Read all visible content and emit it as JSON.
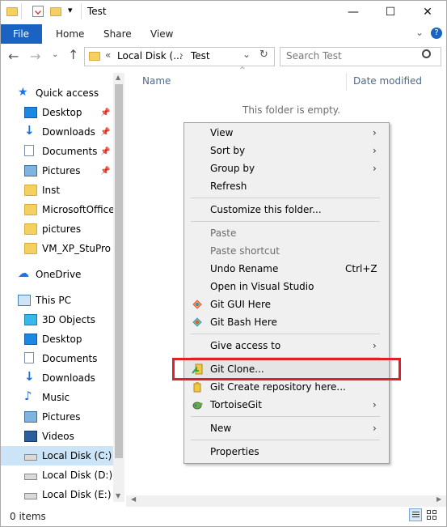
{
  "window": {
    "title": "Test",
    "minimize": "—",
    "maximize": "☐",
    "close": "✕"
  },
  "ribbon": {
    "file": "File",
    "home": "Home",
    "share": "Share",
    "view": "View",
    "expand": "⌄",
    "help": "?"
  },
  "address": {
    "prefix": "«",
    "crumb1": "Local Disk (...",
    "crumb_sep": "›",
    "crumb2": "Test",
    "dropdown": "⌄",
    "refresh": "↻",
    "search_placeholder": "Search Test"
  },
  "sidebar": {
    "quick_access": "Quick access",
    "desktop": "Desktop",
    "downloads": "Downloads",
    "documents": "Documents",
    "pictures": "Pictures",
    "inst": "Inst",
    "microsoftoffice": "MicrosoftOffice",
    "pictures_lower": "pictures",
    "vm": "VM_XP_StuPro",
    "onedrive": "OneDrive",
    "this_pc": "This PC",
    "objects3d": "3D Objects",
    "pc_desktop": "Desktop",
    "pc_documents": "Documents",
    "pc_downloads": "Downloads",
    "music": "Music",
    "pc_pictures": "Pictures",
    "videos": "Videos",
    "disk_c": "Local Disk (C:)",
    "disk_d": "Local Disk (D:)",
    "disk_e": "Local Disk (E:)"
  },
  "content": {
    "col_name": "Name",
    "col_date": "Date modified",
    "empty": "This folder is empty."
  },
  "menu": {
    "view": "View",
    "sort_by": "Sort by",
    "group_by": "Group by",
    "refresh": "Refresh",
    "customize": "Customize this folder...",
    "paste": "Paste",
    "paste_shortcut": "Paste shortcut",
    "undo_rename": "Undo Rename",
    "undo_shortcut": "Ctrl+Z",
    "open_vs": "Open in Visual Studio",
    "git_gui": "Git GUI Here",
    "git_bash": "Git Bash Here",
    "give_access": "Give access to",
    "git_clone": "Git Clone...",
    "git_create": "Git Create repository here...",
    "tortoisegit": "TortoiseGit",
    "new": "New",
    "properties": "Properties",
    "chevron": "›"
  },
  "status": {
    "items": "0 items"
  },
  "colors": {
    "accent": "#1a63c2",
    "highlight_box": "#e11f26",
    "selection": "#cce4f7"
  }
}
